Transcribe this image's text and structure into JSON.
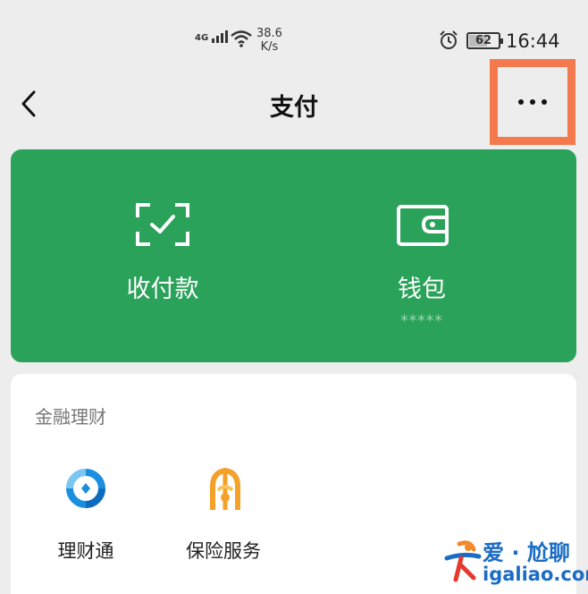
{
  "status_bar": {
    "network": "4G",
    "speed_value": "38.6",
    "speed_unit": "K/s",
    "battery": "62",
    "time": "16:44",
    "icons": [
      "signal-icon",
      "wifi-icon",
      "alarm-icon",
      "battery-icon"
    ]
  },
  "nav": {
    "title": "支付",
    "back_icon": "chevron-left-icon",
    "more_icon": "more-dots-icon",
    "highlight_color": "#f47a4d"
  },
  "pay_card": {
    "color": "#2aa25a",
    "items": [
      {
        "label": "收付款",
        "icon": "scan-check-icon"
      },
      {
        "label": "钱包",
        "sub": "*****",
        "icon": "wallet-icon"
      }
    ]
  },
  "finance": {
    "title": "金融理财",
    "items": [
      {
        "label": "理财通",
        "icon": "licaitong-icon"
      },
      {
        "label": "保险服务",
        "icon": "insurance-icon"
      }
    ]
  },
  "watermark": {
    "line1": "爱 · 尬聊",
    "line2": "igaliao.com"
  }
}
